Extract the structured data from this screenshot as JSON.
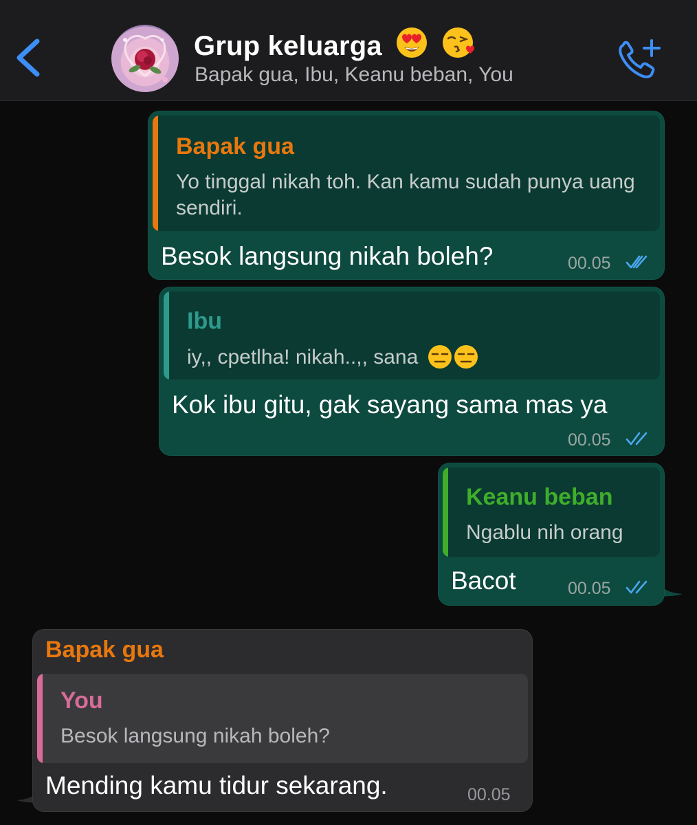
{
  "header": {
    "title": "Grup keluarga",
    "subtitle": "Bapak gua, Ibu, Keanu beban, You"
  },
  "colors": {
    "accent": "#3d8ef5",
    "outgoing_bubble": "#0d4a3f",
    "incoming_bubble": "#2c2c2e",
    "bapak": "#e8780e",
    "ibu": "#2d9a8c",
    "keanu": "#3fae2a",
    "you": "#d86b97"
  },
  "messages": [
    {
      "quote_name": "Bapak gua",
      "quote_text": "Yo tinggal nikah toh. Kan kamu sudah punya uang sendiri.",
      "text": "Besok langsung nikah boleh?",
      "time": "00.05"
    },
    {
      "quote_name": "Ibu",
      "quote_text": "iy,, cpetlha! nikah..,, sana",
      "text": "Kok ibu gitu, gak sayang sama mas ya",
      "time": "00.05"
    },
    {
      "quote_name": "Keanu beban",
      "quote_text": "Ngablu nih orang",
      "text": "Bacot",
      "time": "00.05"
    },
    {
      "sender": "Bapak gua",
      "quote_name": "You",
      "quote_text": "Besok langsung nikah boleh?",
      "text": "Mending kamu tidur sekarang.",
      "time": "00.05"
    }
  ]
}
